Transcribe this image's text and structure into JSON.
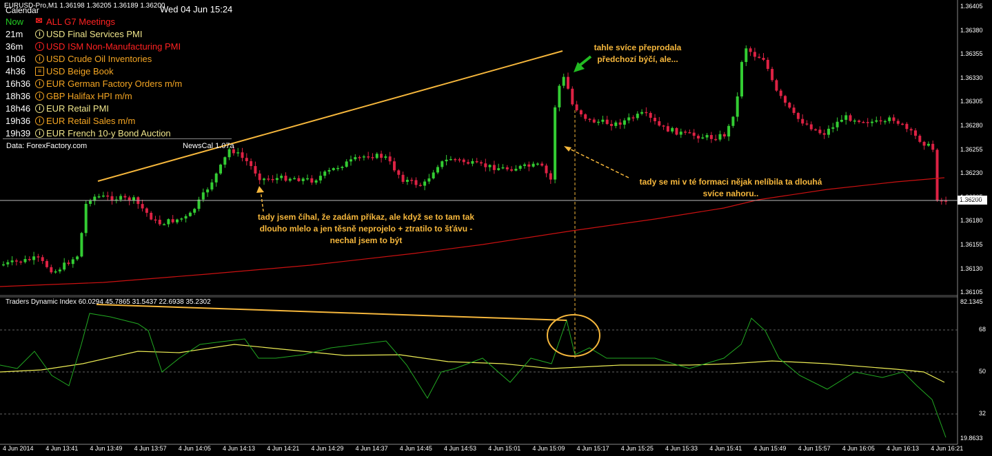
{
  "window": {
    "symbol_line": "EURUSD-Pro,M1  1.36198 1.36205 1.36189 1.36200",
    "calendar_title": "Calendar",
    "datetime": "Wed 04 Jun 15:24"
  },
  "news": [
    {
      "time": "Now",
      "currency": "ALL",
      "event": "G7 Meetings",
      "color": "#ff2222",
      "time_color": "#22cc22",
      "icon": "speech-icon"
    },
    {
      "time": "21m",
      "currency": "USD",
      "event": "Final Services PMI",
      "color": "#f0e68c",
      "time_color": "#ffffff",
      "icon": "info-icon"
    },
    {
      "time": "36m",
      "currency": "USD",
      "event": "ISM Non-Manufacturing PMI",
      "color": "#ff2222",
      "time_color": "#ffffff",
      "icon": "info-icon"
    },
    {
      "time": "1h06",
      "currency": "USD",
      "event": "Crude Oil Inventories",
      "color": "#f5a623",
      "time_color": "#ffffff",
      "icon": "info-icon"
    },
    {
      "time": "4h36",
      "currency": "USD",
      "event": "Beige Book",
      "color": "#f5a623",
      "time_color": "#ffffff",
      "icon": "document-icon"
    },
    {
      "time": "16h36",
      "currency": "EUR",
      "event": "German Factory Orders m/m",
      "color": "#f5a623",
      "time_color": "#ffffff",
      "icon": "info-icon"
    },
    {
      "time": "18h36",
      "currency": "GBP",
      "event": "Halifax HPI m/m",
      "color": "#f5a623",
      "time_color": "#ffffff",
      "icon": "info-icon"
    },
    {
      "time": "18h46",
      "currency": "EUR",
      "event": "Retail PMI",
      "color": "#f0e68c",
      "time_color": "#ffffff",
      "icon": "info-icon"
    },
    {
      "time": "19h36",
      "currency": "EUR",
      "event": "Retail Sales m/m",
      "color": "#f5a623",
      "time_color": "#ffffff",
      "icon": "info-icon"
    },
    {
      "time": "19h39",
      "currency": "EUR",
      "event": "French 10-y Bond Auction",
      "color": "#f0e68c",
      "time_color": "#ffffff",
      "icon": "info-icon"
    }
  ],
  "panel_footer": {
    "source": "Data: ForexFactory.com",
    "version": "NewsCal 1.07a"
  },
  "annotations": {
    "top_right_line1": "tahle svíce přeprodala",
    "top_right_line2": "předchozí býčí, ale...",
    "mid_right_line1": "tady se mi v té formaci nějak nelíbila ta dlouhá",
    "mid_right_line2": "svíce nahoru..",
    "left_line1": "tady jsem číhal, že zadám příkaz, ale když se to tam tak",
    "left_line2": "dlouho mlelo a jen těsně neprojelo + ztratilo to šťávu -",
    "left_line3": "nechal jsem to být"
  },
  "indicator": {
    "title": "Traders Dynamic Index 60.0294 45.7865 31.5437 22.6938 35.2302",
    "levels": [
      "82.1345",
      "68",
      "50",
      "32",
      "19.8633"
    ]
  },
  "price_axis": [
    "1.36405",
    "1.36380",
    "1.36355",
    "1.36330",
    "1.36305",
    "1.36280",
    "1.36255",
    "1.36230",
    "1.36205",
    "1.36180",
    "1.36155",
    "1.36130",
    "1.36105"
  ],
  "current_price": "1.36200",
  "time_axis": [
    "4 Jun 2014",
    "4 Jun 13:41",
    "4 Jun 13:49",
    "4 Jun 13:57",
    "4 Jun 14:05",
    "4 Jun 14:13",
    "4 Jun 14:21",
    "4 Jun 14:29",
    "4 Jun 14:37",
    "4 Jun 14:45",
    "4 Jun 14:53",
    "4 Jun 15:01",
    "4 Jun 15:09",
    "4 Jun 15:17",
    "4 Jun 15:25",
    "4 Jun 15:33",
    "4 Jun 15:41",
    "4 Jun 15:49",
    "4 Jun 15:57",
    "4 Jun 16:05",
    "4 Jun 16:13",
    "4 Jun 16:21"
  ],
  "colors": {
    "bull": "#33cc33",
    "bear": "#dd2244",
    "ma": "#cc1111",
    "annotation": "#f6b73c",
    "tdi_fast": "#22aa22",
    "tdi_slow": "#eeee55",
    "arrow": "#22bb22"
  }
}
